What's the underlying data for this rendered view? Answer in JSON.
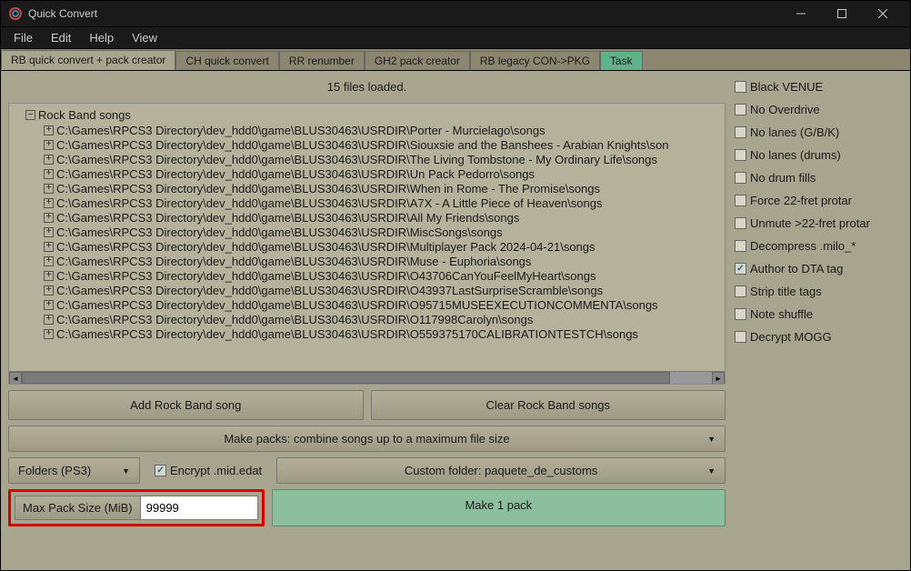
{
  "window": {
    "title": "Quick Convert"
  },
  "menubar": {
    "items": [
      "File",
      "Edit",
      "Help",
      "View"
    ]
  },
  "tabs": {
    "items": [
      {
        "label": "RB quick convert + pack creator",
        "state": "active"
      },
      {
        "label": "CH quick convert",
        "state": ""
      },
      {
        "label": "RR renumber",
        "state": ""
      },
      {
        "label": "GH2 pack creator",
        "state": ""
      },
      {
        "label": "RB legacy CON->PKG",
        "state": ""
      },
      {
        "label": "Task",
        "state": "highlight"
      }
    ]
  },
  "status": {
    "files_loaded": "15 files loaded."
  },
  "tree": {
    "root_label": "Rock Band songs",
    "items": [
      "C:\\Games\\RPCS3 Directory\\dev_hdd0\\game\\BLUS30463\\USRDIR\\Porter - Murcielago\\songs",
      "C:\\Games\\RPCS3 Directory\\dev_hdd0\\game\\BLUS30463\\USRDIR\\Siouxsie and the Banshees - Arabian Knights\\son",
      "C:\\Games\\RPCS3 Directory\\dev_hdd0\\game\\BLUS30463\\USRDIR\\The Living Tombstone - My Ordinary Life\\songs",
      "C:\\Games\\RPCS3 Directory\\dev_hdd0\\game\\BLUS30463\\USRDIR\\Un Pack Pedorro\\songs",
      "C:\\Games\\RPCS3 Directory\\dev_hdd0\\game\\BLUS30463\\USRDIR\\When in Rome - The Promise\\songs",
      "C:\\Games\\RPCS3 Directory\\dev_hdd0\\game\\BLUS30463\\USRDIR\\A7X - A Little Piece of Heaven\\songs",
      "C:\\Games\\RPCS3 Directory\\dev_hdd0\\game\\BLUS30463\\USRDIR\\All My Friends\\songs",
      "C:\\Games\\RPCS3 Directory\\dev_hdd0\\game\\BLUS30463\\USRDIR\\MiscSongs\\songs",
      "C:\\Games\\RPCS3 Directory\\dev_hdd0\\game\\BLUS30463\\USRDIR\\Multiplayer Pack 2024-04-21\\songs",
      "C:\\Games\\RPCS3 Directory\\dev_hdd0\\game\\BLUS30463\\USRDIR\\Muse - Euphoria\\songs",
      "C:\\Games\\RPCS3 Directory\\dev_hdd0\\game\\BLUS30463\\USRDIR\\O43706CanYouFeelMyHeart\\songs",
      "C:\\Games\\RPCS3 Directory\\dev_hdd0\\game\\BLUS30463\\USRDIR\\O43937LastSurpriseScramble\\songs",
      "C:\\Games\\RPCS3 Directory\\dev_hdd0\\game\\BLUS30463\\USRDIR\\O95715MUSEEXECUTIONCOMMENTA\\songs",
      "C:\\Games\\RPCS3 Directory\\dev_hdd0\\game\\BLUS30463\\USRDIR\\O117998Carolyn\\songs",
      "C:\\Games\\RPCS3 Directory\\dev_hdd0\\game\\BLUS30463\\USRDIR\\O559375170CALIBRATIONTESTCH\\songs"
    ]
  },
  "buttons": {
    "add_song": "Add Rock Band song",
    "clear_songs": "Clear Rock Band songs",
    "make_packs": "Make packs: combine songs up to a maximum file size",
    "folders_dd": "Folders (PS3)",
    "encrypt_label": "Encrypt .mid.edat",
    "custom_folder": "Custom folder: paquete_de_customs",
    "max_pack_label": "Max Pack Size (MiB)",
    "max_pack_value": "99999",
    "make_one": "Make 1 pack"
  },
  "options": [
    {
      "label": "Black VENUE",
      "checked": false
    },
    {
      "label": "No Overdrive",
      "checked": false
    },
    {
      "label": "No lanes (G/B/K)",
      "checked": false
    },
    {
      "label": "No lanes (drums)",
      "checked": false
    },
    {
      "label": "No drum fills",
      "checked": false
    },
    {
      "label": "Force 22-fret protar",
      "checked": false
    },
    {
      "label": "Unmute >22-fret protar",
      "checked": false
    },
    {
      "label": "Decompress .milo_*",
      "checked": false
    },
    {
      "label": "Author to DTA tag",
      "checked": true
    },
    {
      "label": "Strip title tags",
      "checked": false
    },
    {
      "label": "Note shuffle",
      "checked": false
    },
    {
      "label": "Decrypt MOGG",
      "checked": false
    }
  ]
}
